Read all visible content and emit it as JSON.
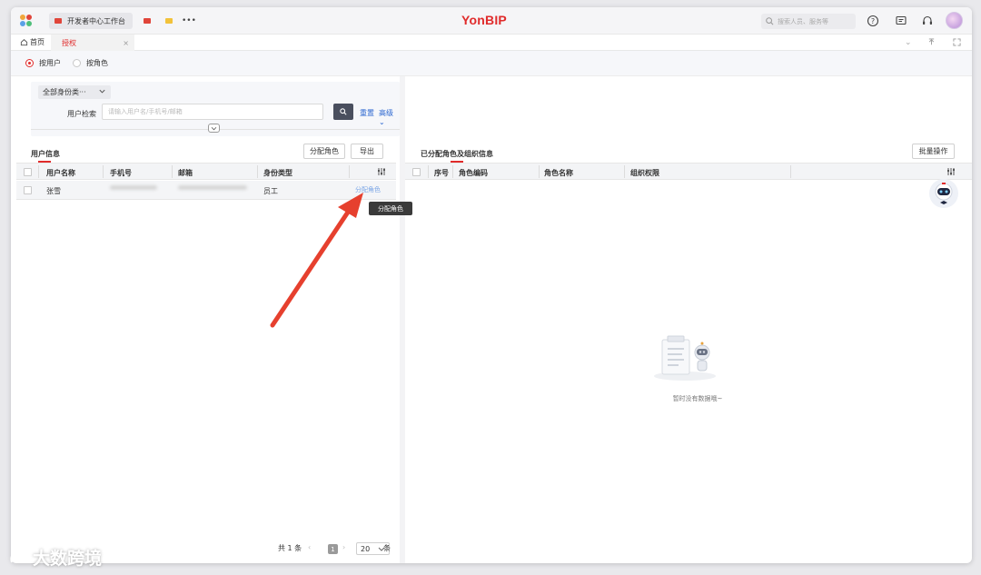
{
  "topbar": {
    "tabs": [
      {
        "label": "开发者中心工作台"
      },
      {
        "label": ""
      },
      {
        "label": ""
      }
    ],
    "more": "•••",
    "brand": "YonBIP",
    "search_placeholder": "搜索人员、服务等"
  },
  "tabstrip": {
    "home": "首页",
    "active_tab": "授权",
    "close": "×"
  },
  "mode": {
    "options": [
      "按用户",
      "按角色"
    ],
    "selected": "按用户"
  },
  "filter": {
    "identity_select": "全部身份类···",
    "search_label": "用户检索",
    "search_placeholder": "请输入用户名/手机号/邮箱",
    "reset": "重置",
    "advanced": "高级"
  },
  "user_panel": {
    "title": "用户信息",
    "assign_button": "分配角色",
    "export_button": "导出",
    "columns": [
      "用户名称",
      "手机号",
      "邮箱",
      "身份类型"
    ],
    "rows": [
      {
        "name": "张雪",
        "identity_type": "员工",
        "action": "分配角色"
      }
    ],
    "tooltip": "分配角色",
    "pager": {
      "total": "共 1 条",
      "page": "1",
      "page_size": "20",
      "unit": "条"
    }
  },
  "role_panel": {
    "title": "已分配角色及组织信息",
    "batch_button": "批量操作",
    "columns": [
      "序号",
      "角色编码",
      "角色名称",
      "组织权限"
    ],
    "empty_text": "暂时没有数据哦~"
  },
  "watermark": "大数跨境",
  "colors": {
    "accent": "#e02b2b",
    "link": "#2a66d0",
    "arrow": "#e6402e"
  }
}
